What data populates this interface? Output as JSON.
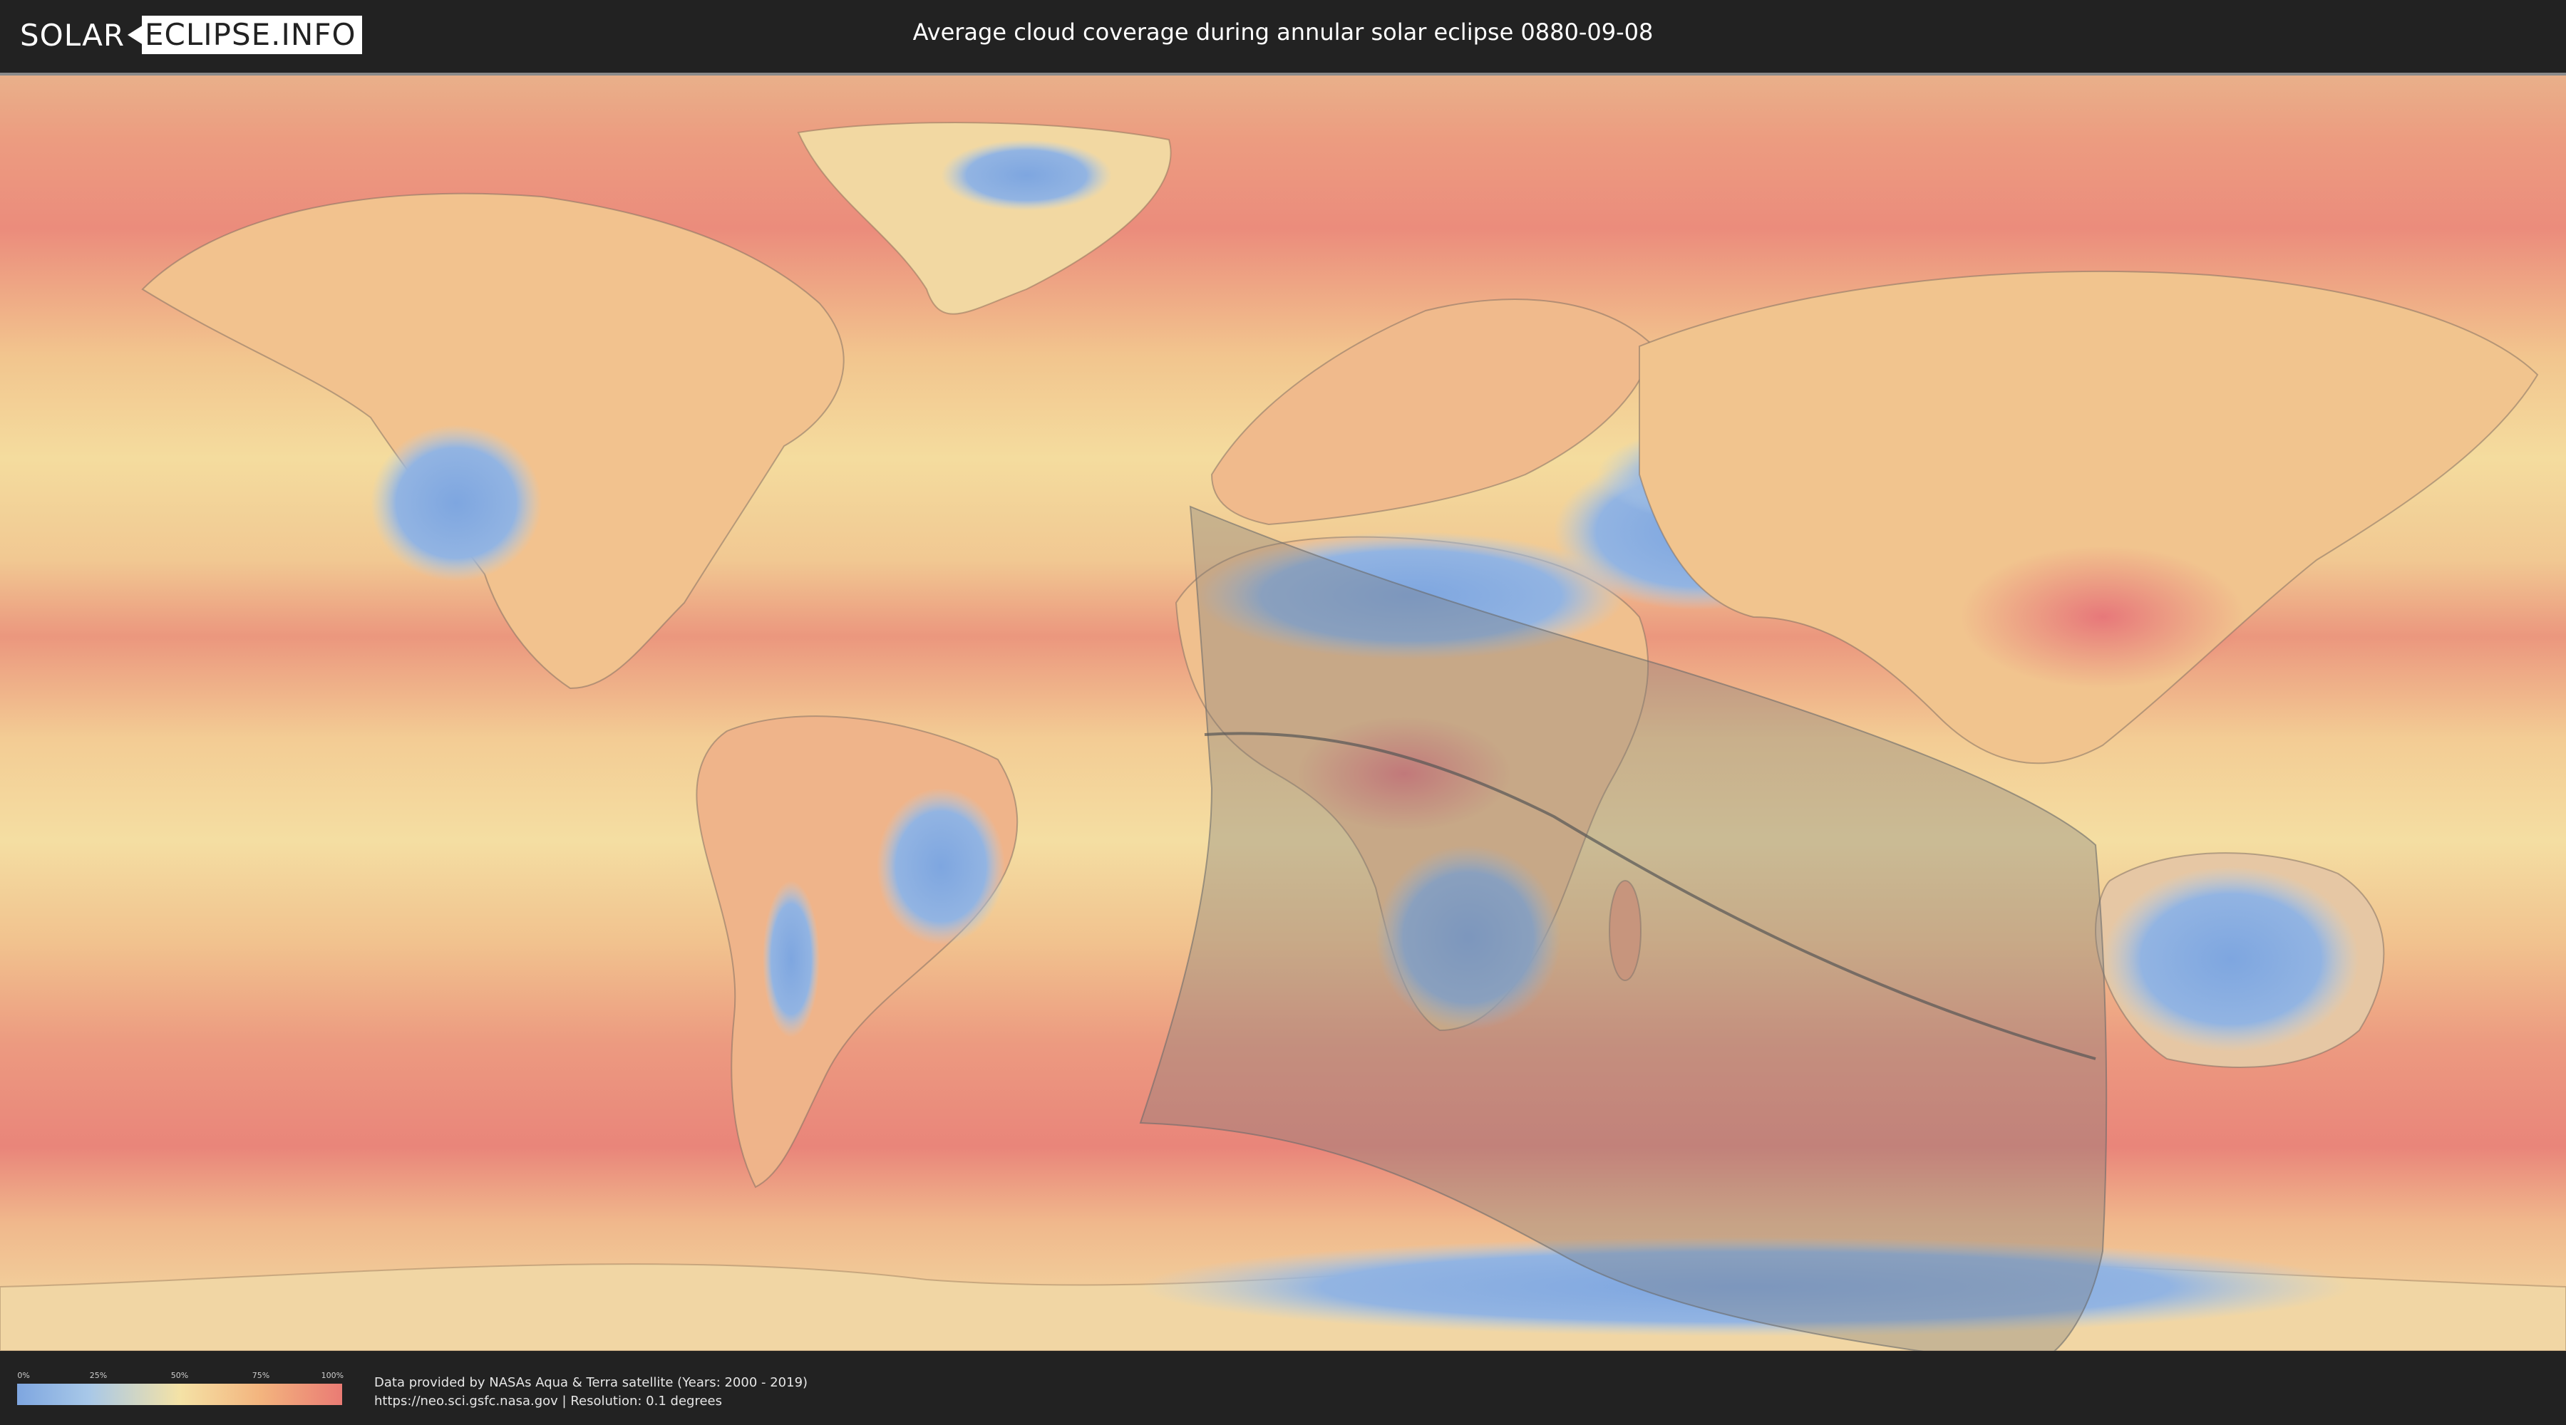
{
  "header": {
    "logo_solar": "SOLAR",
    "logo_eclipse": "ECLIPSE.INFO",
    "title": "Average cloud coverage during annular solar eclipse 0880-09-08"
  },
  "legend": {
    "ticks": [
      "0%",
      "25%",
      "50%",
      "75%",
      "100%"
    ],
    "gradient_colors": [
      "#7ea6e0",
      "#a8c8e8",
      "#f4e2a6",
      "#f3b47e",
      "#ea7b74"
    ]
  },
  "credits": {
    "line1": "Data provided by NASAs Aqua & Terra satellite (Years: 2000 - 2019)",
    "line2": "https://neo.sci.gsfc.nasa.gov | Resolution: 0.1 degrees"
  },
  "map": {
    "projection": "equirectangular",
    "colors": {
      "clear_sky": "#7ea6e0",
      "partly": "#f4e2a6",
      "cloudy": "#ea7b74",
      "eclipse_shadow": "#7a7a7a",
      "central_line": "#555555"
    }
  }
}
